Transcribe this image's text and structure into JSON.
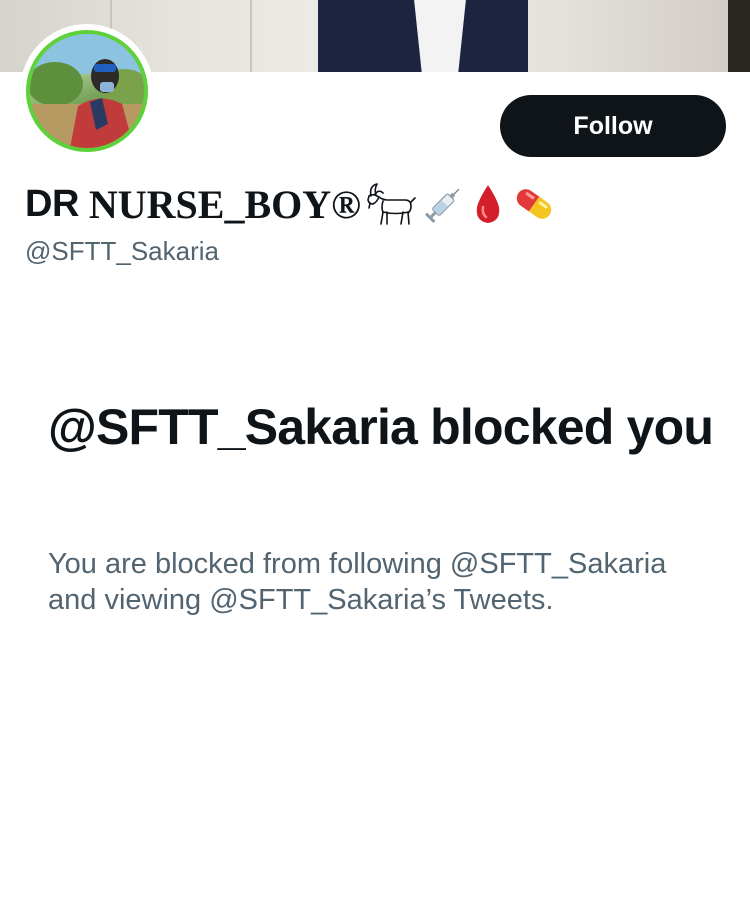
{
  "profile": {
    "display_name_prefix": "DR",
    "display_name_rest": "NURSE_BOY®",
    "handle": "@SFTT_Sakaria",
    "emojis": [
      "goat-icon",
      "syringe-icon",
      "drop-of-blood-icon",
      "pill-icon"
    ],
    "follow_label": "Follow"
  },
  "blocked": {
    "title": "@SFTT_Sakaria blocked you",
    "description": "You are blocked from following @SFTT_Sakaria and viewing @SFTT_Sakaria’s Tweets."
  },
  "colors": {
    "avatar_ring": "#5ed13a",
    "button_bg": "#0f1419",
    "button_text": "#ffffff",
    "secondary_text": "#536471",
    "primary_text": "#0f1419"
  }
}
